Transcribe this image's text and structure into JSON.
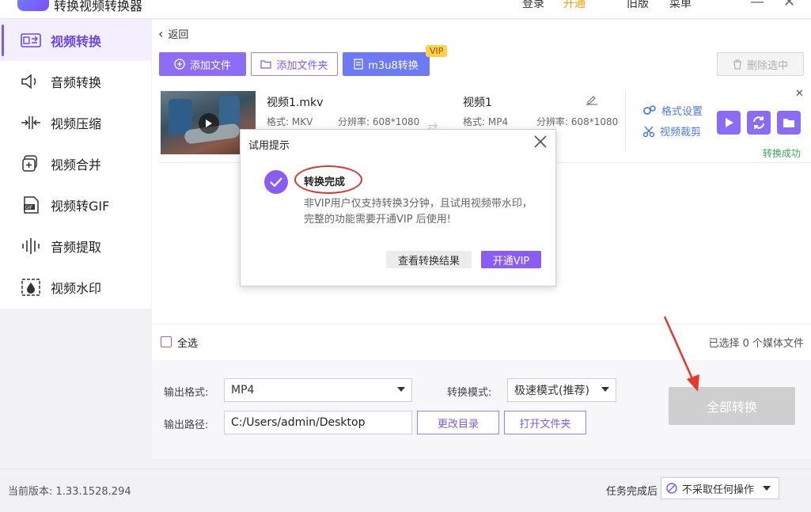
{
  "app": {
    "title": "转换视频转换器",
    "menu_login": "登录",
    "menu_vip": "开通",
    "menu_version": "旧版",
    "menu_more": "菜单"
  },
  "sidebar": {
    "items": [
      {
        "label": "视频转换",
        "icon": "video-convert-icon"
      },
      {
        "label": "音频转换",
        "icon": "audio-convert-icon"
      },
      {
        "label": "视频压缩",
        "icon": "compress-icon"
      },
      {
        "label": "视频合并",
        "icon": "merge-icon"
      },
      {
        "label": "视频转GIF",
        "icon": "gif-icon"
      },
      {
        "label": "音频提取",
        "icon": "audio-extract-icon"
      },
      {
        "label": "视频水印",
        "icon": "watermark-icon"
      }
    ]
  },
  "toolbar": {
    "back": "返回",
    "add_file": "添加文件",
    "add_folder": "添加文件夹",
    "m3u8": "m3u8转换",
    "vip_badge": "VIP",
    "delete_selected": "删除选中"
  },
  "file": {
    "source_name": "视频1.mkv",
    "source_format": "格式: MKV",
    "source_resolution": "分辨率: 608*1080",
    "output_name": "视频1",
    "output_format": "格式: MP4",
    "output_resolution": "分辨率: 608*1080",
    "format_settings": "格式设置",
    "video_crop": "视频裁剪",
    "status": "转换成功"
  },
  "dialog": {
    "title": "试用提示",
    "heading": "转换完成",
    "message": "非VIP用户仅支持转换3分钟，且试用视频带水印，完整的功能需要开通VIP 后使用!",
    "view_result": "查看转换结果",
    "open_vip": "开通VIP"
  },
  "selection": {
    "select_all": "全选",
    "count_text": "已选择 0 个媒体文件"
  },
  "output": {
    "format_label": "输出格式:",
    "format_value": "MP4",
    "mode_label": "转换模式:",
    "mode_value": "极速模式(推荐)",
    "path_label": "输出路径:",
    "path_value": "C:/Users/admin/Desktop",
    "change_dir": "更改目录",
    "open_folder": "打开文件夹",
    "convert_all": "全部转换"
  },
  "statusbar": {
    "version": "当前版本: 1.33.1528.294",
    "after_label": "任务完成后",
    "after_value": "不采取任何操作"
  },
  "colors": {
    "accent": "#8a5cf6",
    "link": "#4b7be5",
    "success": "#3aa853",
    "annotation": "#d9362b"
  }
}
